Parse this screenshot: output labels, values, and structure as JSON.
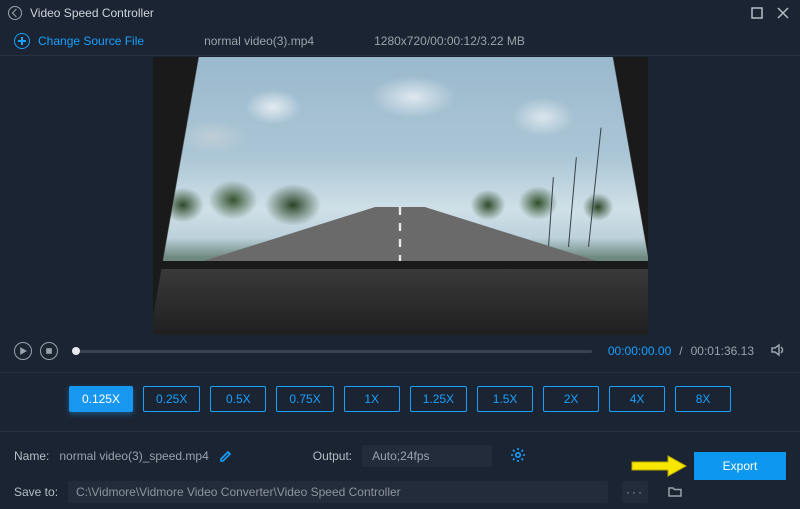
{
  "title": "Video Speed Controller",
  "source": {
    "change_label": "Change Source File",
    "filename": "normal video(3).mp4",
    "meta": "1280x720/00:00:12/3.22 MB"
  },
  "transport": {
    "current": "00:00:00.00",
    "duration": "00:01:36.13"
  },
  "speeds": {
    "options": [
      "0.125X",
      "0.25X",
      "0.5X",
      "0.75X",
      "1X",
      "1.25X",
      "1.5X",
      "2X",
      "4X",
      "8X"
    ],
    "active_index": 0
  },
  "output": {
    "name_label": "Name:",
    "name_value": "normal video(3)_speed.mp4",
    "output_label": "Output:",
    "output_value": "Auto;24fps",
    "saveto_label": "Save to:",
    "saveto_path": "C:\\Vidmore\\Vidmore Video Converter\\Video Speed Controller",
    "export_label": "Export"
  }
}
